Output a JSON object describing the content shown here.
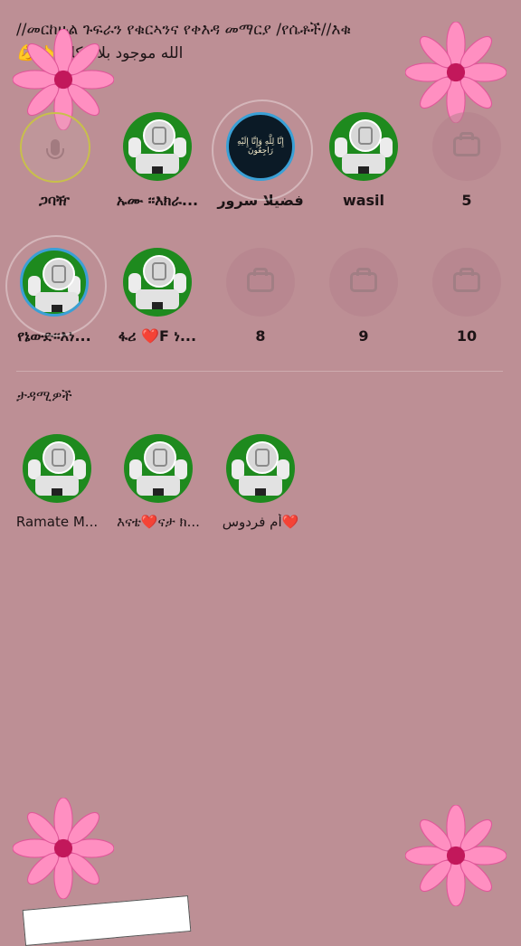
{
  "header": {
    "title_line1": "//መርከዙል ጉፍራን የቁርኣንና የቀእዳ መማርያ /የሴቶች//እቁ",
    "title_line2": "الله موجود بلا مكان 👈💪"
  },
  "seats_row1": [
    {
      "label": "ጋባዥ",
      "type": "mic"
    },
    {
      "label": "ኡሙ ፡፡እክራ...",
      "type": "avatar"
    },
    {
      "label": "فضيلا سرور",
      "type": "dark",
      "dark_text": "إِنَّا لِلَّهِ وَإِنَّا إِلَيْهِ رَاجِعُونَ"
    },
    {
      "label": "wasil",
      "type": "avatar"
    },
    {
      "label": "5",
      "type": "empty"
    }
  ],
  "seats_row2": [
    {
      "label": "የኔውድ፡፡እነ...",
      "type": "avatar"
    },
    {
      "label": "ፋሪ ❤️F ነ...",
      "type": "avatar"
    },
    {
      "label": "8",
      "type": "empty"
    },
    {
      "label": "9",
      "type": "empty"
    },
    {
      "label": "10",
      "type": "empty"
    }
  ],
  "audience_title": "ታዳሚዎች",
  "audience": [
    {
      "label": "Ramate   M..."
    },
    {
      "label": "እናቴ❤️ናታ ክ..."
    },
    {
      "label": "أم فردوس❤️"
    }
  ],
  "colors": {
    "background": "#bd8f95",
    "avatar_green": "#1e8a1e",
    "accent_ring": "#3aa0d6"
  }
}
